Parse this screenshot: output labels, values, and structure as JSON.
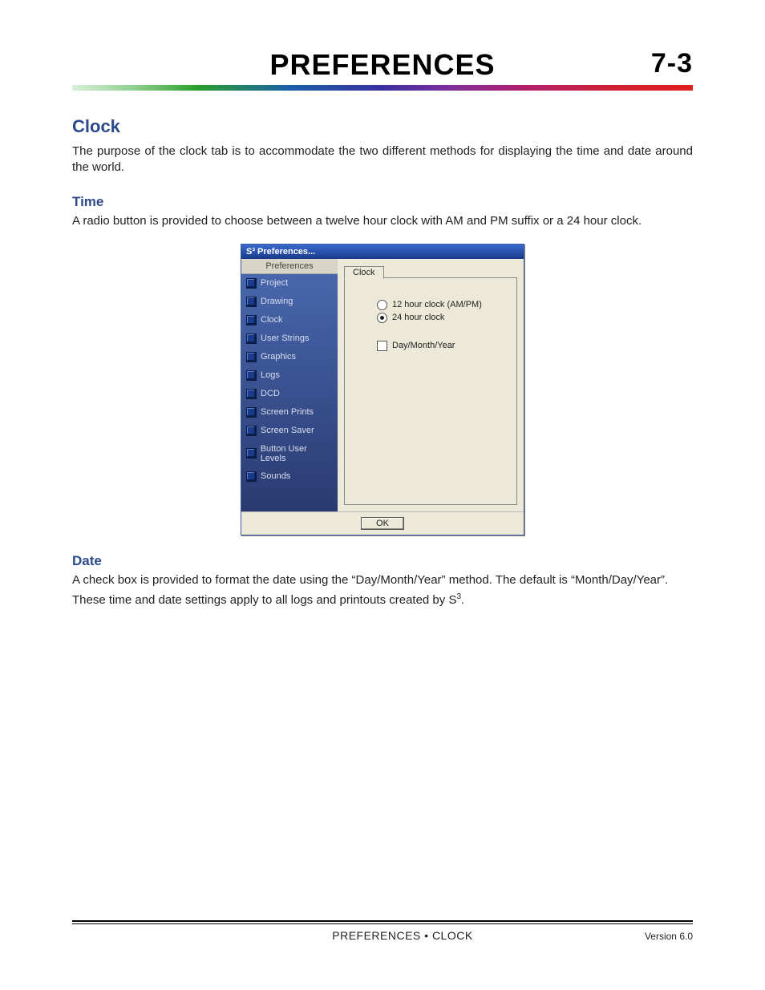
{
  "header": {
    "title": "PREFERENCES",
    "pageNum": "7-3"
  },
  "section_clock": {
    "heading": "Clock",
    "intro": "The purpose of the clock tab is to accommodate the two different methods for displaying the time and date around the world."
  },
  "section_time": {
    "heading": "Time",
    "body": "A radio button is provided to choose between a twelve hour clock with AM and PM suffix or a 24 hour clock."
  },
  "section_date": {
    "heading": "Date",
    "body1": "A check box is provided to format the date using the “Day/Month/Year” method.  The default is “Month/Day/Year”.",
    "body2_prefix": "These time and date settings apply to all logs and printouts created by S",
    "body2_sup": "3",
    "body2_suffix": "."
  },
  "dialog": {
    "title": "S³ Preferences...",
    "sidebarHeader": "Preferences",
    "items": [
      "Project",
      "Drawing",
      "Clock",
      "User Strings",
      "Graphics",
      "Logs",
      "DCD",
      "Screen Prints",
      "Screen Saver",
      "Button User Levels",
      "Sounds"
    ],
    "tab": "Clock",
    "opt12": "12 hour clock (AM/PM)",
    "opt24": "24 hour clock",
    "optDate": "Day/Month/Year",
    "ok": "OK"
  },
  "footer": {
    "center": "PREFERENCES • CLOCK",
    "right": "Version 6.0"
  }
}
